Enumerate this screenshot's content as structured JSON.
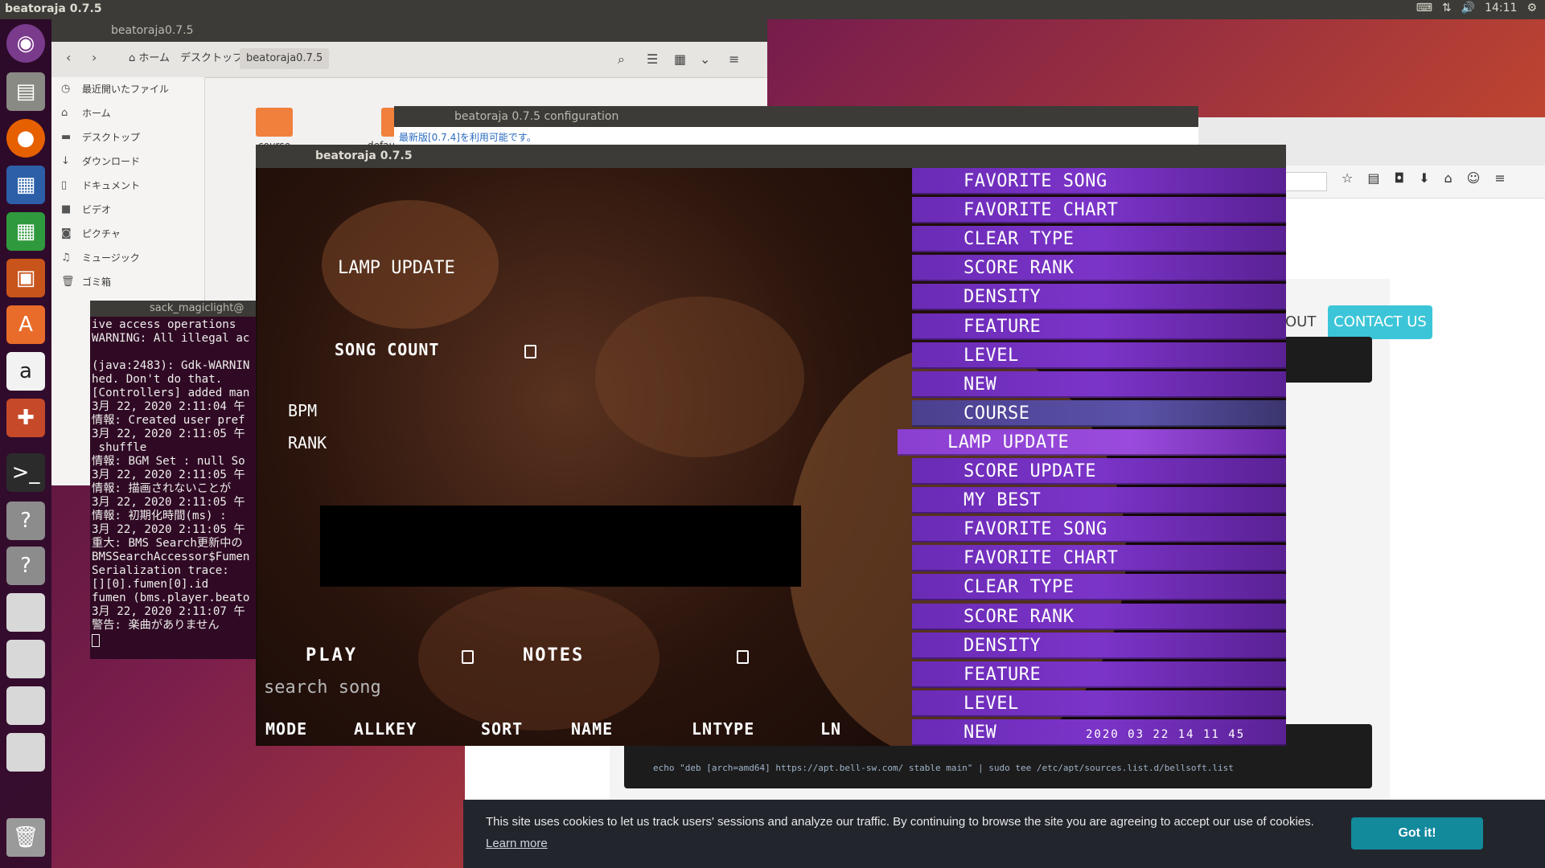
{
  "topbar": {
    "title": "beatoraja 0.7.5",
    "clock": "14:11"
  },
  "filemanager": {
    "title": "beatoraja0.7.5",
    "crumbs": [
      "ホーム",
      "デスクトップ",
      "beatoraja0.7.5"
    ],
    "sidebar": [
      "最近開いたファイル",
      "ホーム",
      "デスクトップ",
      "ダウンロード",
      "ドキュメント",
      "ビデオ",
      "ピクチャ",
      "ミュージック",
      "ゴミ箱"
    ],
    "folders": [
      "course",
      "defau"
    ]
  },
  "config": {
    "title": "beatoraja 0.7.5 configuration",
    "message": "最新版[0.7.4]を利用可能です。"
  },
  "browser": {
    "about": "OUT",
    "contact": "CONTACT US",
    "code_line": "echo \"deb [arch=amd64] https://apt.bell-sw.com/ stable main\" | sudo tee /etc/apt/sources.list.d/bellsoft.list",
    "cookie_text": "This site uses cookies to let us track users' sessions and analyze our traffic. By continuing to browse the site you are agreeing to accept our use of cookies.",
    "cookie_link": "Learn more",
    "cookie_button": "Got it!"
  },
  "terminal": {
    "title": "sack_magiclight@",
    "lines": [
      "ive access operations",
      "WARNING: All illegal ac",
      "",
      "(java:2483): Gdk-WARNIN",
      "hed. Don't do that.",
      "[Controllers] added man",
      "3月 22, 2020 2:11:04 午",
      "情報: Created user pref",
      "3月 22, 2020 2:11:05 午",
      " shuffle",
      "情報: BGM Set : null So",
      "3月 22, 2020 2:11:05 午",
      "情報: 描画されないことが",
      "3月 22, 2020 2:11:05 午",
      "情報: 初期化時間(ms) :",
      "3月 22, 2020 2:11:05 午",
      "重大: BMS Search更新中の",
      "BMSSearchAccessor$Fumen",
      "Serialization trace:",
      "[][0].fumen[0].id",
      "fumen (bms.player.beato",
      "3月 22, 2020 2:11:07 午",
      "警告: 楽曲がありません"
    ]
  },
  "game": {
    "window_title": "beatoraja 0.7.5",
    "folder_title": "LAMP UPDATE",
    "song_count_label": "SONG COUNT",
    "song_count": "0",
    "bpm_label": "BPM",
    "rank_label": "RANK",
    "play_label": "PLAY",
    "play_value": "0",
    "notes_label": "NOTES",
    "notes_value": "0",
    "search_placeholder": "search song",
    "footer": {
      "mode": "MODE",
      "allkey": "ALLKEY",
      "sort": "SORT",
      "name": "NAME",
      "lntype": "LNTYPE",
      "ln": "LN"
    },
    "clock": "2020 03 22  14 11 45",
    "list": [
      {
        "label": "FAVORITE SONG",
        "kind": "folder"
      },
      {
        "label": "FAVORITE CHART",
        "kind": "folder"
      },
      {
        "label": "CLEAR TYPE",
        "kind": "folder"
      },
      {
        "label": "SCORE RANK",
        "kind": "folder"
      },
      {
        "label": "DENSITY",
        "kind": "folder"
      },
      {
        "label": "FEATURE",
        "kind": "folder"
      },
      {
        "label": "LEVEL",
        "kind": "folder"
      },
      {
        "label": "NEW",
        "kind": "folder"
      },
      {
        "label": "COURSE",
        "kind": "course"
      },
      {
        "label": "LAMP UPDATE",
        "kind": "selected"
      },
      {
        "label": "SCORE UPDATE",
        "kind": "folder"
      },
      {
        "label": "MY BEST",
        "kind": "folder"
      },
      {
        "label": "FAVORITE SONG",
        "kind": "folder"
      },
      {
        "label": "FAVORITE CHART",
        "kind": "folder"
      },
      {
        "label": "CLEAR TYPE",
        "kind": "folder"
      },
      {
        "label": "SCORE RANK",
        "kind": "folder"
      },
      {
        "label": "DENSITY",
        "kind": "folder"
      },
      {
        "label": "FEATURE",
        "kind": "folder"
      },
      {
        "label": "LEVEL",
        "kind": "folder"
      },
      {
        "label": "NEW",
        "kind": "folder"
      }
    ]
  }
}
